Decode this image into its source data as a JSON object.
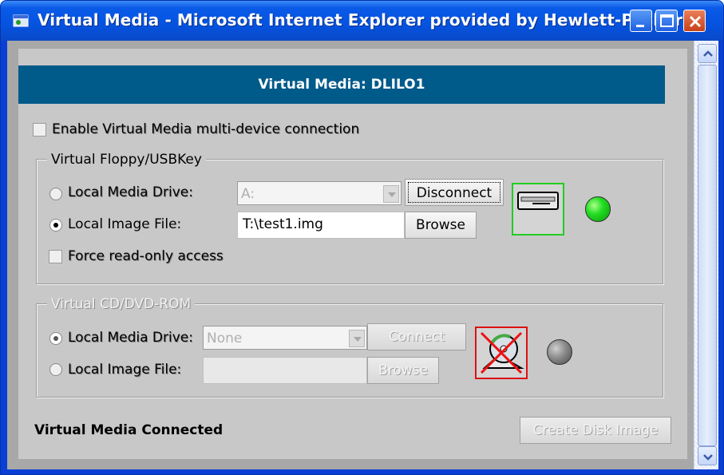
{
  "window": {
    "title": "Virtual Media - Microsoft Internet Explorer provided by Hewlett-Packard",
    "buttons": [
      "minimize-icon",
      "maximize-icon",
      "close-icon"
    ]
  },
  "header": {
    "title": "Virtual Media: DLILO1"
  },
  "multi_device": {
    "label": "Enable Virtual Media multi-device connection",
    "checked": false,
    "enabled": false
  },
  "floppy": {
    "legend": "Virtual Floppy/USBKey",
    "media_drive": {
      "label": "Local Media Drive:",
      "selected": false,
      "enabled": false,
      "value": "A:"
    },
    "image_file": {
      "label": "Local Image File:",
      "selected": true,
      "value": "T:\\test1.img"
    },
    "disconnect_label": "Disconnect",
    "browse_label": "Browse",
    "readonly": {
      "label": "Force read-only access",
      "checked": false,
      "enabled": false
    },
    "device_icon": "floppy-drive-icon",
    "status_led": "green"
  },
  "cdrom": {
    "legend": "Virtual CD/DVD-ROM",
    "media_drive": {
      "label": "Local Media Drive:",
      "selected": true,
      "enabled": false,
      "value": "None"
    },
    "image_file": {
      "label": "Local Image File:",
      "selected": false,
      "enabled": false,
      "value": ""
    },
    "connect_label": "Connect",
    "browse_label": "Browse",
    "device_icon": "cd-disconnected-icon",
    "status_led": "gray"
  },
  "status_text": "Virtual Media Connected",
  "create_disk_image_label": "Create Disk Image",
  "colors": {
    "titlebar": "#0553e0",
    "header_bg": "#005a8a",
    "panel_bg": "#c8c8c8",
    "floppy_icon_border": "#22cc22",
    "cd_icon_border": "#dd1111"
  }
}
